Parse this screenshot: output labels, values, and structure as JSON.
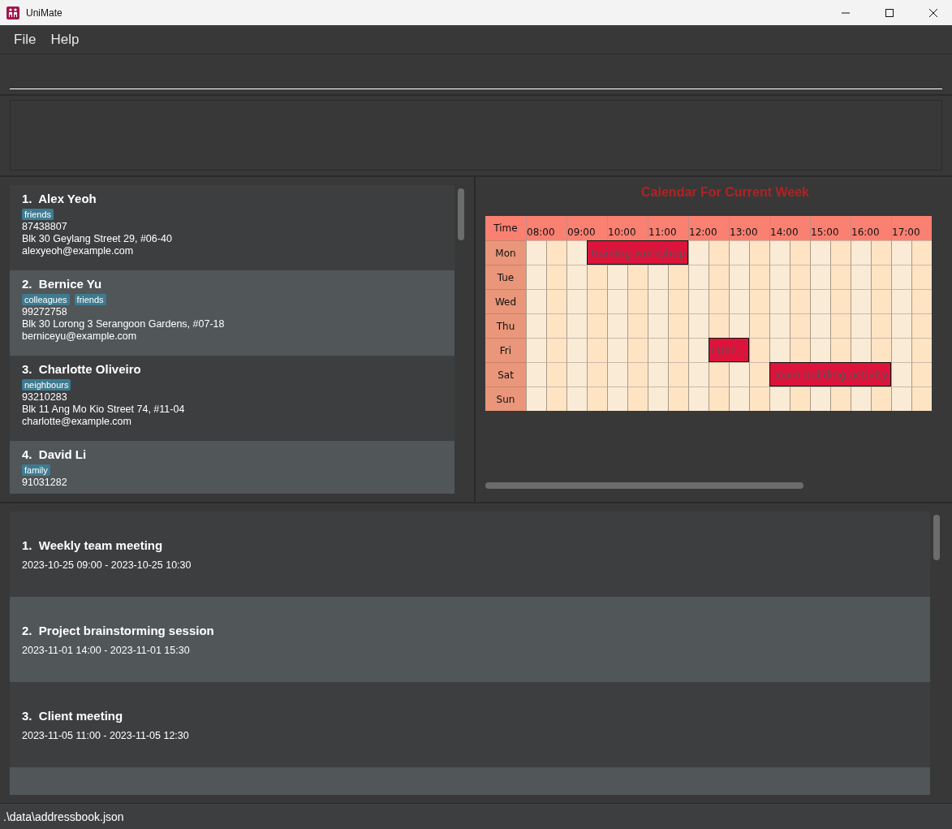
{
  "window": {
    "title": "UniMate"
  },
  "menu": [
    "File",
    "Help"
  ],
  "persons": [
    {
      "index": "1.",
      "name": "Alex Yeoh",
      "tags": [
        "friends"
      ],
      "phone": "87438807",
      "address": "Blk 30 Geylang Street 29, #06-40",
      "email": "alexyeoh@example.com"
    },
    {
      "index": "2.",
      "name": "Bernice Yu",
      "tags": [
        "colleagues",
        "friends"
      ],
      "phone": "99272758",
      "address": "Blk 30 Lorong 3 Serangoon Gardens, #07-18",
      "email": "berniceyu@example.com"
    },
    {
      "index": "3.",
      "name": "Charlotte Oliveiro",
      "tags": [
        "neighbours"
      ],
      "phone": "93210283",
      "address": "Blk 11 Ang Mo Kio Street 74, #11-04",
      "email": "charlotte@example.com"
    },
    {
      "index": "4.",
      "name": "David Li",
      "tags": [
        "family"
      ],
      "phone": "91031282"
    }
  ],
  "calendar": {
    "title": "Calendar For Current Week",
    "corner": "Time",
    "hours": [
      "08:00",
      "09:00",
      "10:00",
      "11:00",
      "12:00",
      "13:00",
      "14:00",
      "15:00",
      "16:00",
      "17:00"
    ],
    "days": [
      {
        "label": "Mon",
        "events": [
          "Training workshop"
        ]
      },
      {
        "label": "Tue"
      },
      {
        "label": "Wed"
      },
      {
        "label": "Thu"
      },
      {
        "label": "Fri",
        "events": [
          "Lunc..."
        ]
      },
      {
        "label": "Sat",
        "events": [
          "Team building activity"
        ]
      },
      {
        "label": "Sun"
      }
    ]
  },
  "events": [
    {
      "index": "1.",
      "name": "Weekly team meeting",
      "time": "2023-10-25 09:00 - 2023-10-25 10:30"
    },
    {
      "index": "2.",
      "name": "Project brainstorming session",
      "time": "2023-11-01 14:00 - 2023-11-01 15:30"
    },
    {
      "index": "3.",
      "name": "Client meeting",
      "time": "2023-11-05 11:00 - 2023-11-05 12:30"
    }
  ],
  "status_bar": ".\\data\\addressbook.json"
}
